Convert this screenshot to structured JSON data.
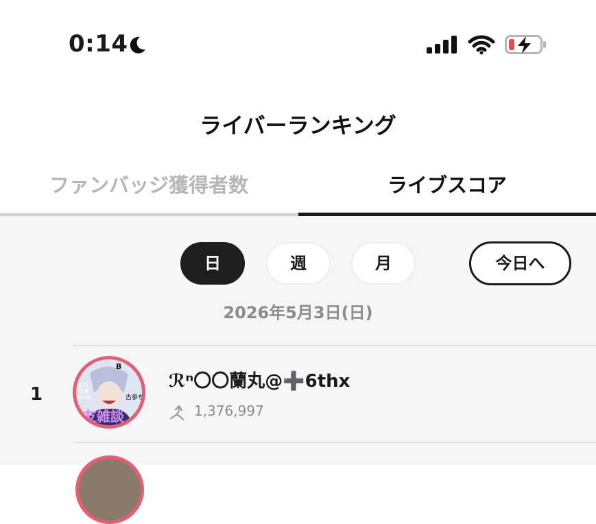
{
  "status_bar": {
    "time": "0:14",
    "icons": [
      "moon-icon",
      "signal-icon",
      "wifi-icon",
      "battery-charging-icon"
    ],
    "battery_color": "#e8474d"
  },
  "header": {
    "title": "ライバーランキング"
  },
  "tabs": [
    {
      "label": "ファンバッジ獲得者数",
      "active": false
    },
    {
      "label": "ライブスコア",
      "active": true
    }
  ],
  "period_filter": {
    "options": [
      {
        "label": "日",
        "selected": true
      },
      {
        "label": "週",
        "selected": false
      },
      {
        "label": "月",
        "selected": false
      }
    ],
    "today_button": "今日へ"
  },
  "date": "2026年5月3日(日)",
  "ranking": [
    {
      "rank": "1",
      "name": "ℛⁿ〇〇蘭丸@➕6thx",
      "score": "1,376,997",
      "score_icon": "score-arrow-icon",
      "avatar_border_color": "#e35f72",
      "avatar_text": {
        "top_right": "B",
        "side_right": "古参ちゃん",
        "left_lines": [
          "初見",
          "常連",
          "ROM"
        ],
        "bottom": "友雑談"
      }
    }
  ],
  "colors": {
    "accent_dark": "#1e1e1e",
    "inactive_tab": "#b6b6b6",
    "secondary_text": "#8c8c8c",
    "background": "#f6f6f6"
  }
}
